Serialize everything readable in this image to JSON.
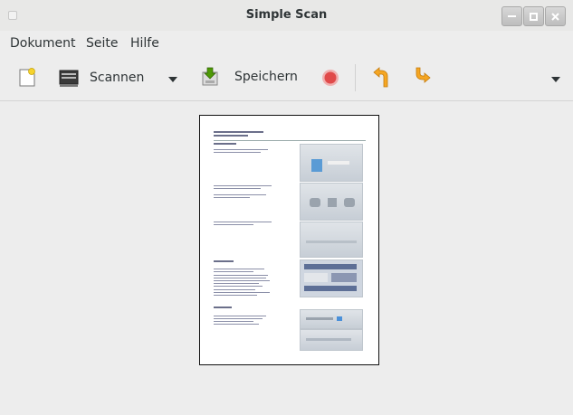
{
  "window": {
    "title": "Simple Scan"
  },
  "menubar": {
    "items": [
      "Dokument",
      "Seite",
      "Hilfe"
    ]
  },
  "toolbar": {
    "new_icon": "new-document-icon",
    "scan_label": "Scannen",
    "save_label": "Speichern",
    "icons": [
      "new-document-icon",
      "scanner-icon",
      "dropdown-arrow-icon",
      "save-icon",
      "stop-icon",
      "rotate-left-icon",
      "rotate-right-icon",
      "overflow-menu-icon"
    ]
  },
  "page_preview": {
    "heading_lines": [
      "TA Triumph-Adler DCC 2520",
      "Bedienungsanleitung"
    ],
    "sections": [
      "Anmeldung",
      "Kopieren",
      "Scannen"
    ]
  },
  "colors": {
    "stop": "#e04a4a",
    "rotate": "#f0a020",
    "accent": "#4a90d9"
  }
}
